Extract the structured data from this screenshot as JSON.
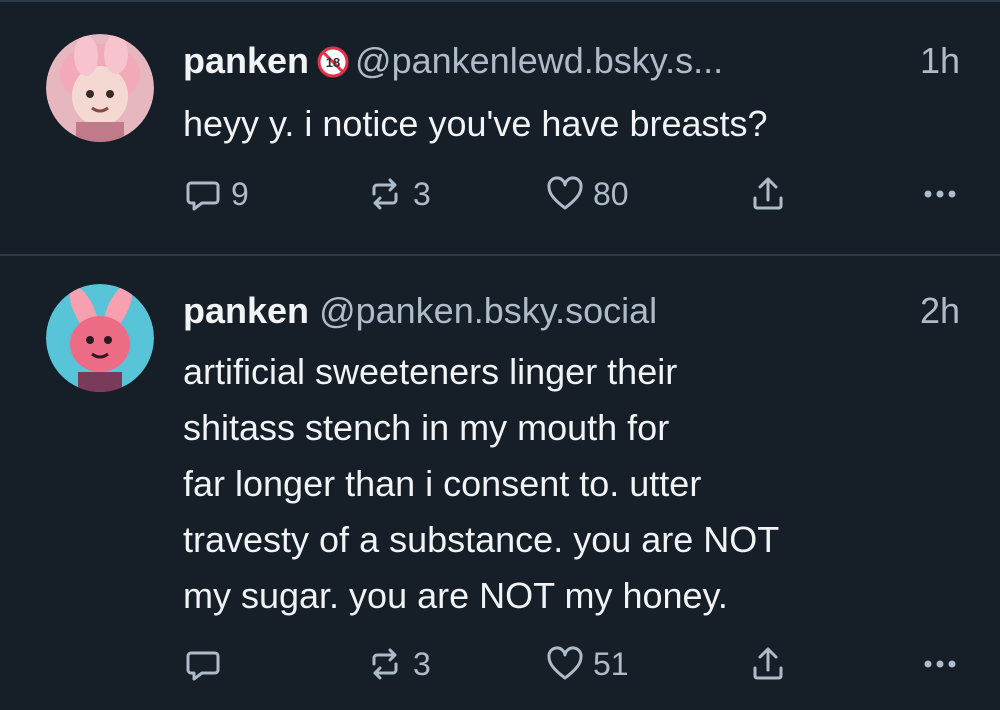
{
  "posts": [
    {
      "display_name": "panken",
      "handle": "@pankenlewd.bsky.s...",
      "time": "1h",
      "badge": "18",
      "text_lines": [
        "heyy y. i notice you've have breasts?"
      ],
      "reply_count": "9",
      "repost_count": "3",
      "like_count": "80",
      "avatar_colors": {
        "bg": "#e6b7bf",
        "skin": "#f4d9d3",
        "hair": "#f2a9b8"
      }
    },
    {
      "display_name": "panken",
      "handle": "@panken.bsky.social",
      "time": "2h",
      "text_lines": [
        "artificial sweeteners linger their",
        "shitass stench in my mouth for",
        "far longer than i consent to. utter",
        "travesty of a substance. you are NOT",
        "my sugar. you are NOT my honey."
      ],
      "repost_count": "3",
      "like_count": "51",
      "avatar_colors": {
        "bg": "#58c4d8",
        "skin": "#ec6c85",
        "hair": "#f6a0b0"
      }
    }
  ],
  "icons": {
    "reply": "reply-bubble-icon",
    "repost": "repost-icon",
    "like": "heart-icon",
    "share": "share-icon",
    "more": "more-dots-icon",
    "badge": "18-plus-badge-icon"
  },
  "colors": {
    "background": "#161e27",
    "divider": "#2e3a47",
    "text": "#f1f3f5",
    "muted": "#aebbc9",
    "badge_red": "#e0334a"
  }
}
